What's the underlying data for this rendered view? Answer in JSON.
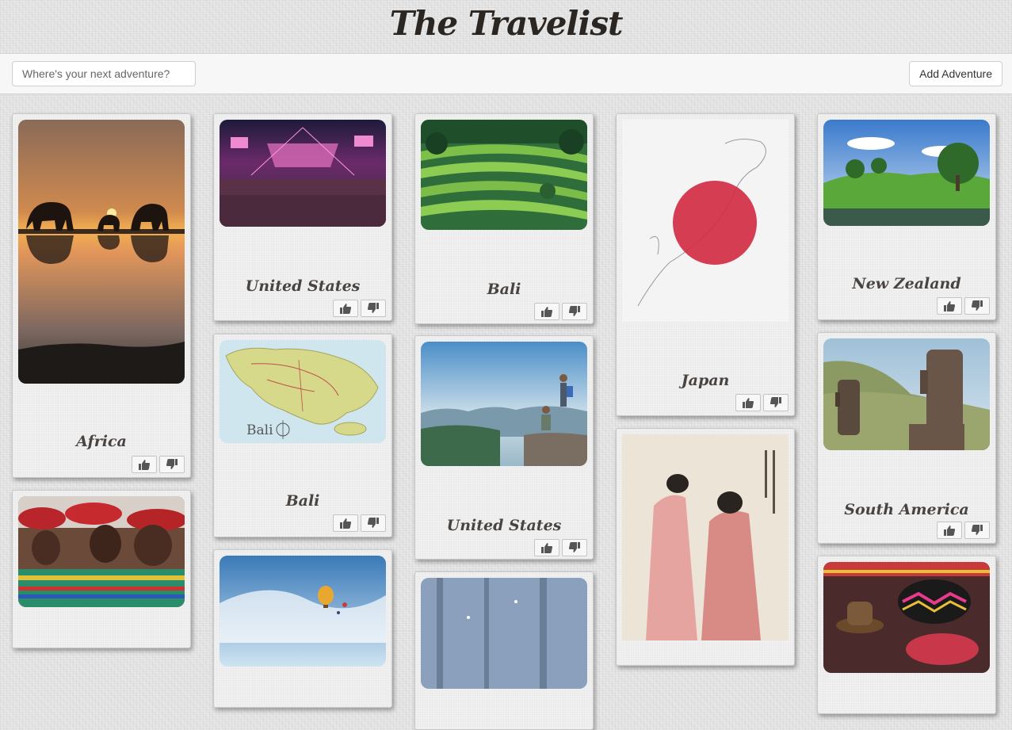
{
  "header": {
    "title": "The Travelist"
  },
  "toolbar": {
    "search_placeholder": "Where's your next adventure?",
    "add_label": "Add Adventure"
  },
  "cards": [
    {
      "name": "Africa",
      "image": "elephants-sunset"
    },
    {
      "name": "",
      "image": "tribal-dancers"
    },
    {
      "name": "United States",
      "image": "concert-crowd"
    },
    {
      "name": "Bali",
      "image": "bali-map",
      "map_label": "Bali"
    },
    {
      "name": "",
      "image": "hot-air-balloons"
    },
    {
      "name": "Bali",
      "image": "rice-terraces"
    },
    {
      "name": "United States",
      "image": "hikers-mountain"
    },
    {
      "name": "",
      "image": "snowy-forest"
    },
    {
      "name": "Japan",
      "image": "japan-flag-map"
    },
    {
      "name": "",
      "image": "ukiyo-e-print"
    },
    {
      "name": "New Zealand",
      "image": "green-hills-lake"
    },
    {
      "name": "South America",
      "image": "moai-statues"
    },
    {
      "name": "",
      "image": "colorful-market-hats"
    }
  ],
  "icons": {
    "like": "thumbs-up-icon",
    "dislike": "thumbs-down-icon"
  },
  "colors": {
    "title": "#2b2622",
    "card_name": "#4a4441",
    "japan_red": "#d12c44"
  }
}
